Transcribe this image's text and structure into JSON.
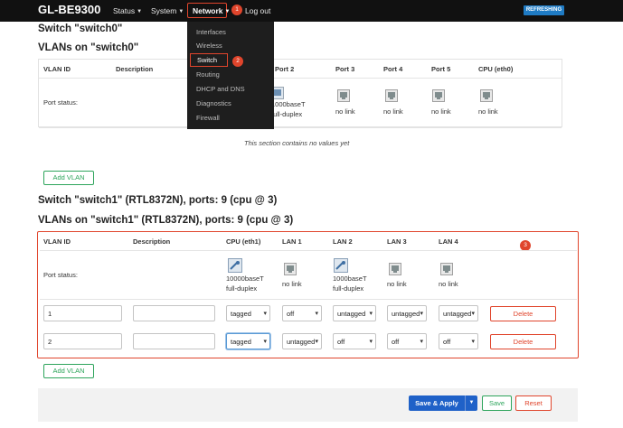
{
  "header": {
    "brand": "GL-BE9300",
    "nav": {
      "status": "Status",
      "system": "System",
      "network": "Network",
      "logout": "Log out"
    },
    "badge1": "1",
    "refresh": "REFRESHING"
  },
  "dropdown": {
    "items": [
      "Interfaces",
      "Wireless",
      "Switch",
      "Routing",
      "DHCP and DNS",
      "Diagnostics",
      "Firewall"
    ],
    "badge2": "2"
  },
  "switch0": {
    "title": "Switch \"switch0\"",
    "vlans_title": "VLANs on \"switch0\"",
    "columns": [
      "VLAN ID",
      "Description",
      "Port 2",
      "Port 3",
      "Port 4",
      "Port 5",
      "CPU (eth0)"
    ],
    "port_status_label": "Port status:",
    "port2_status": [
      "1000baseT",
      "full-duplex"
    ],
    "port3_status": "no link",
    "port4_status": "no link",
    "port5_status": "no link",
    "cpu_status": "no link",
    "empty_message": "This section contains no values yet",
    "add_vlan": "Add VLAN"
  },
  "switch1": {
    "title": "Switch \"switch1\" (RTL8372N), ports: 9 (cpu @ 3)",
    "vlans_title": "VLANs on \"switch1\" (RTL8372N), ports: 9 (cpu @ 3)",
    "columns": [
      "VLAN ID",
      "Description",
      "CPU (eth1)",
      "LAN 1",
      "LAN 2",
      "LAN 3",
      "LAN 4"
    ],
    "badge3": "3",
    "port_status_label": "Port status:",
    "cpu_status": [
      "10000baseT",
      "full-duplex"
    ],
    "lan1_status": "no link",
    "lan2_status": [
      "1000baseT",
      "full-duplex"
    ],
    "lan3_status": "no link",
    "lan4_status": "no link",
    "rows": [
      {
        "vlan_id": "1",
        "description": "",
        "cpu": "tagged",
        "lan1": "off",
        "lan2": "untagged",
        "lan3": "untagged",
        "lan4": "untagged",
        "delete": "Delete"
      },
      {
        "vlan_id": "2",
        "description": "",
        "cpu": "tagged",
        "lan1": "untagged",
        "lan2": "off",
        "lan3": "off",
        "lan4": "off",
        "delete": "Delete"
      }
    ],
    "add_vlan": "Add VLAN"
  },
  "footer": {
    "save_apply": "Save & Apply",
    "save": "Save",
    "reset": "Reset"
  },
  "colors": {
    "accent_red": "#e0452c",
    "primary_blue": "#1f61c8",
    "green": "#2da45b",
    "nav_bg": "#111111"
  }
}
